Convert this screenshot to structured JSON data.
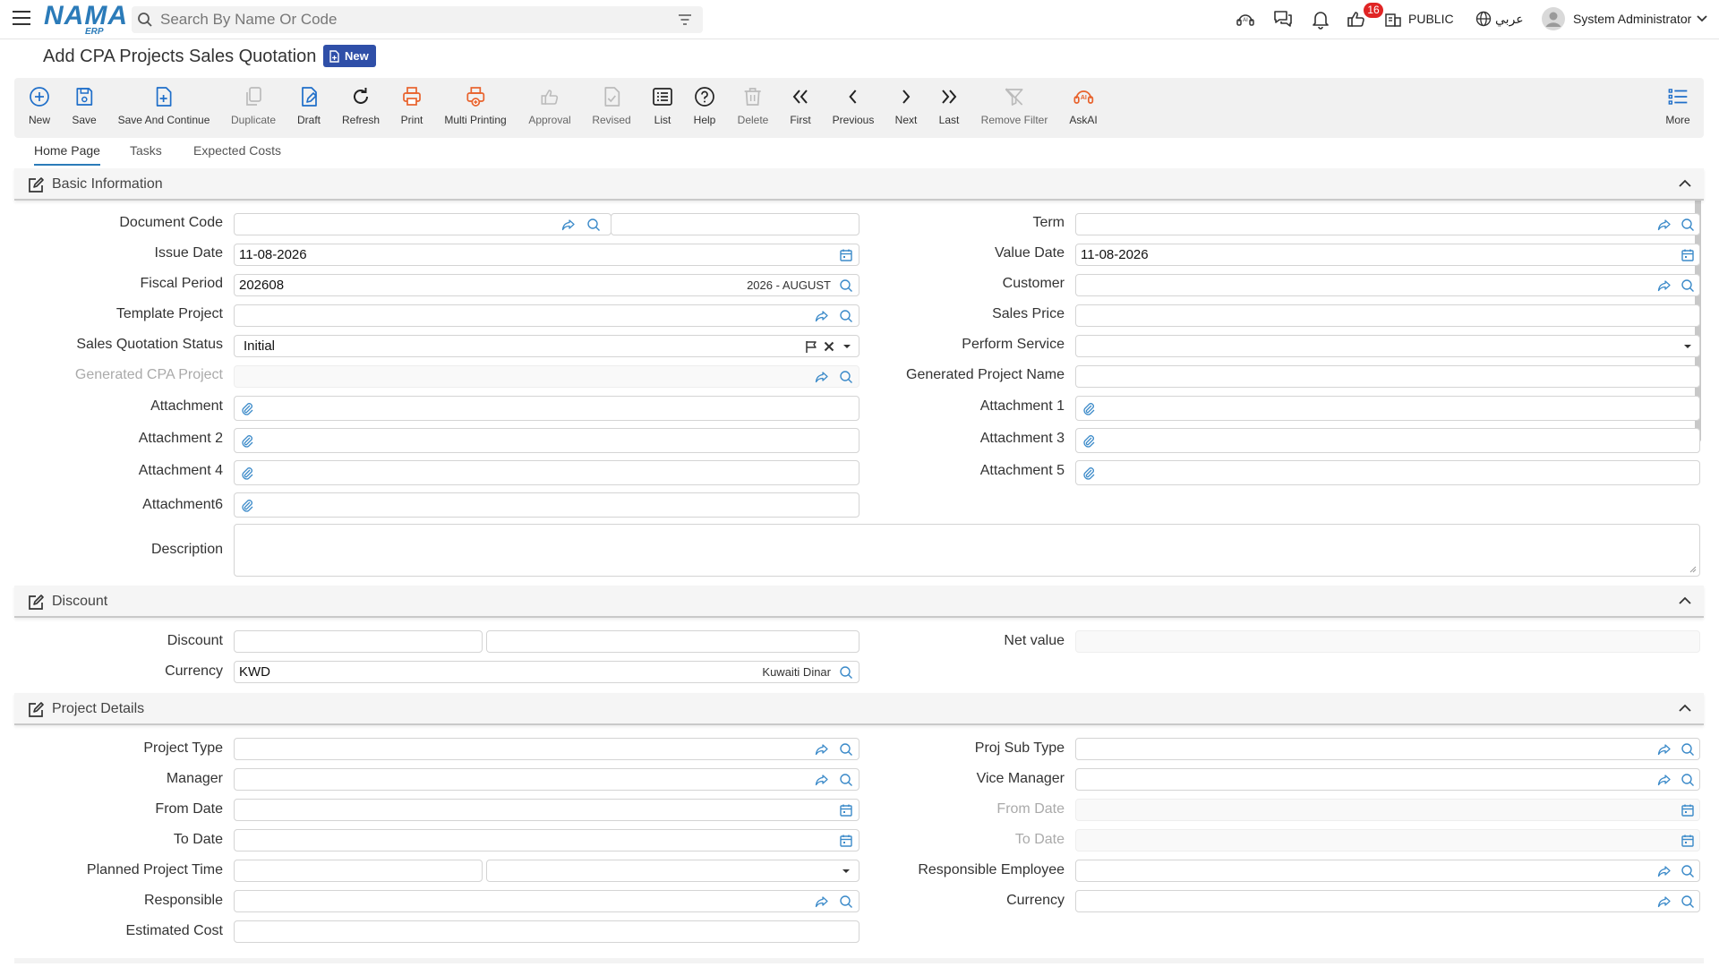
{
  "header": {
    "logo": "NAMA",
    "logo_sub": "ERP",
    "search_placeholder": "Search By Name Or Code",
    "notification_count": "16",
    "company": "PUBLIC",
    "language": "عربي",
    "user": "System Administrator"
  },
  "page": {
    "title": "Add CPA Projects Sales Quotation",
    "status": "New"
  },
  "toolbar": {
    "new": "New",
    "save": "Save",
    "save_continue": "Save And Continue",
    "duplicate": "Duplicate",
    "draft": "Draft",
    "refresh": "Refresh",
    "print": "Print",
    "multi_printing": "Multi Printing",
    "approval": "Approval",
    "revised": "Revised",
    "list": "List",
    "help": "Help",
    "delete": "Delete",
    "first": "First",
    "previous": "Previous",
    "next": "Next",
    "last": "Last",
    "remove_filter": "Remove Filter",
    "askai": "AskAI",
    "more": "More"
  },
  "tabs": {
    "home": "Home Page",
    "tasks": "Tasks",
    "expected_costs": "Expected Costs"
  },
  "basic": {
    "title": "Basic Information",
    "document_code": "Document Code",
    "issue_date": "Issue Date",
    "issue_date_value": "11-08-2026",
    "fiscal_period": "Fiscal Period",
    "fiscal_period_value": "202608",
    "fiscal_period_desc": "2026 - AUGUST",
    "template_project": "Template Project",
    "sales_quotation_status": "Sales Quotation Status",
    "sales_quotation_status_value": "Initial",
    "generated_cpa_project": "Generated CPA Project",
    "attachment": "Attachment",
    "attachment_2": "Attachment 2",
    "attachment_4": "Attachment 4",
    "attachment_6": "Attachment6",
    "term": "Term",
    "value_date": "Value Date",
    "value_date_value": "11-08-2026",
    "customer": "Customer",
    "sales_price": "Sales Price",
    "perform_service": "Perform Service",
    "generated_project_name": "Generated Project Name",
    "attachment_1": "Attachment 1",
    "attachment_3": "Attachment 3",
    "attachment_5": "Attachment 5",
    "description": "Description"
  },
  "discount": {
    "title": "Discount",
    "discount": "Discount",
    "currency": "Currency",
    "currency_value": "KWD",
    "currency_desc": "Kuwaiti Dinar",
    "net_value": "Net value"
  },
  "project": {
    "title": "Project Details",
    "project_type": "Project Type",
    "manager": "Manager",
    "from_date": "From Date",
    "to_date": "To Date",
    "planned_project_time": "Planned Project Time",
    "responsible": "Responsible",
    "estimated_cost": "Estimated Cost",
    "proj_sub_type": "Proj Sub Type",
    "vice_manager": "Vice Manager",
    "from_date_r": "From Date",
    "to_date_r": "To Date",
    "responsible_employee": "Responsible Employee",
    "currency": "Currency"
  }
}
